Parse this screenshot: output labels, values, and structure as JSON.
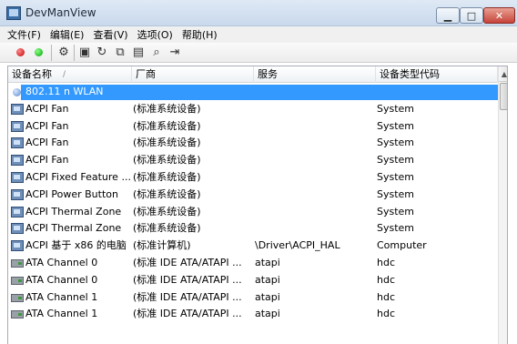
{
  "window": {
    "title": "DevManView",
    "minimize": "▁",
    "maximize": "□",
    "close": "✕"
  },
  "menu": [
    "文件(F)",
    "编辑(E)",
    "查看(V)",
    "选项(O)",
    "帮助(H)"
  ],
  "toolbar": {
    "icons": [
      "enable-device-icon",
      "disable-device-icon",
      "save-icon",
      "refresh-icon",
      "copy-icon",
      "properties-icon",
      "find-icon",
      "exit-icon"
    ],
    "colors": {
      "enable": "#00a000",
      "disable": "#c00000"
    }
  },
  "columns": {
    "name": "设备名称",
    "manufacturer": "厂商",
    "service": "服务",
    "type": "设备类型代码"
  },
  "rows": [
    {
      "icon": "wlan-icon",
      "name": "802.11 n WLAN",
      "manufacturer": "",
      "service": "",
      "type": "",
      "selected": true
    },
    {
      "icon": "system-device-icon",
      "name": "ACPI Fan",
      "manufacturer": "(标准系统设备)",
      "service": "",
      "type": "System"
    },
    {
      "icon": "system-device-icon",
      "name": "ACPI Fan",
      "manufacturer": "(标准系统设备)",
      "service": "",
      "type": "System"
    },
    {
      "icon": "system-device-icon",
      "name": "ACPI Fan",
      "manufacturer": "(标准系统设备)",
      "service": "",
      "type": "System"
    },
    {
      "icon": "system-device-icon",
      "name": "ACPI Fan",
      "manufacturer": "(标准系统设备)",
      "service": "",
      "type": "System"
    },
    {
      "icon": "system-device-icon",
      "name": "ACPI Fixed Feature ...",
      "manufacturer": "(标准系统设备)",
      "service": "",
      "type": "System"
    },
    {
      "icon": "system-device-icon",
      "name": "ACPI Power Button",
      "manufacturer": "(标准系统设备)",
      "service": "",
      "type": "System"
    },
    {
      "icon": "system-device-icon",
      "name": "ACPI Thermal Zone",
      "manufacturer": "(标准系统设备)",
      "service": "",
      "type": "System"
    },
    {
      "icon": "system-device-icon",
      "name": "ACPI Thermal Zone",
      "manufacturer": "(标准系统设备)",
      "service": "",
      "type": "System"
    },
    {
      "icon": "system-device-icon",
      "name": "ACPI 基于 x86 的电脑",
      "manufacturer": "(标准计算机)",
      "service": "\\Driver\\ACPI_HAL",
      "type": "Computer"
    },
    {
      "icon": "ide-controller-icon",
      "name": "ATA Channel 0",
      "manufacturer": "(标准 IDE ATA/ATAPI ...",
      "service": "atapi",
      "type": "hdc"
    },
    {
      "icon": "ide-controller-icon",
      "name": "ATA Channel 0",
      "manufacturer": "(标准 IDE ATA/ATAPI ...",
      "service": "atapi",
      "type": "hdc"
    },
    {
      "icon": "ide-controller-icon",
      "name": "ATA Channel 1",
      "manufacturer": "(标准 IDE ATA/ATAPI ...",
      "service": "atapi",
      "type": "hdc"
    },
    {
      "icon": "ide-controller-icon",
      "name": "ATA Channel 1",
      "manufacturer": "(标准 IDE ATA/ATAPI ...",
      "service": "atapi",
      "type": "hdc"
    }
  ],
  "selection_color": "#3399ff"
}
